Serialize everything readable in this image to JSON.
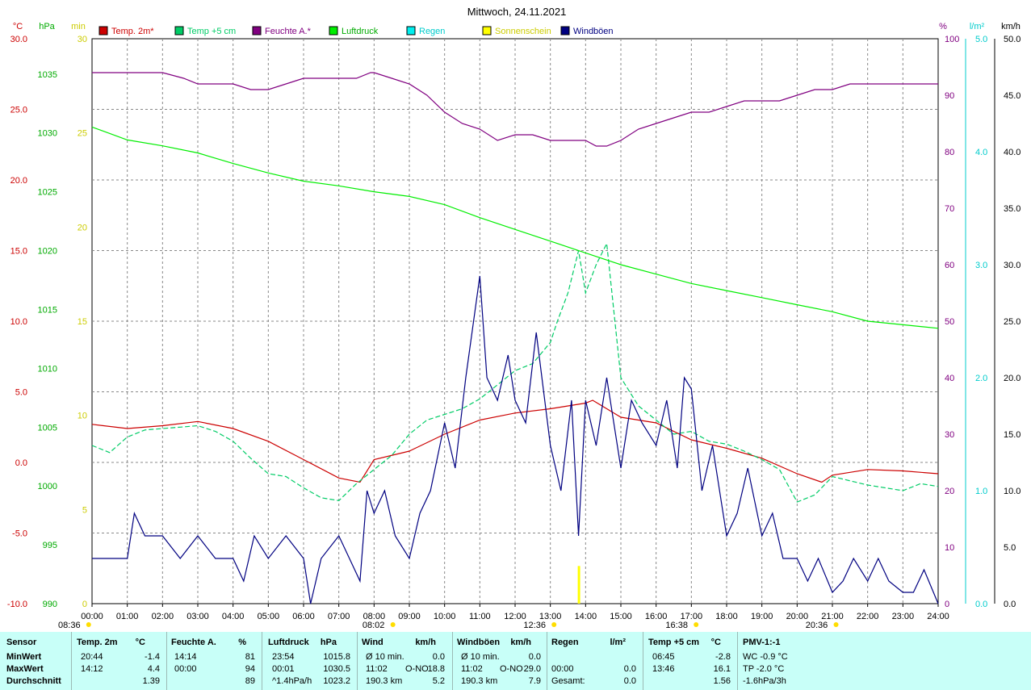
{
  "chart_data": {
    "type": "line",
    "title": "Mittwoch, 24.11.2021",
    "x_ticks": [
      "00:00",
      "01:00",
      "02:00",
      "03:00",
      "04:00",
      "05:00",
      "06:00",
      "07:00",
      "08:00",
      "09:00",
      "10:00",
      "11:00",
      "12:00",
      "13:00",
      "14:00",
      "15:00",
      "16:00",
      "17:00",
      "18:00",
      "19:00",
      "20:00",
      "21:00",
      "22:00",
      "23:00",
      "24:00"
    ],
    "axes": {
      "temp": {
        "unit": "°C",
        "ticks": [
          "30.0",
          "25.0",
          "20.0",
          "15.0",
          "10.0",
          "5.0",
          "0.0",
          "-5.0",
          "-10.0"
        ],
        "range": [
          -10,
          30
        ],
        "color": "#cc0000"
      },
      "pressure": {
        "unit": "hPa",
        "ticks": [
          "1035",
          "1030",
          "1025",
          "1020",
          "1015",
          "1010",
          "1005",
          "1000",
          "995",
          "990"
        ],
        "range": [
          990,
          1038
        ],
        "color": "#00aa00"
      },
      "sunshine": {
        "unit": "min",
        "ticks": [
          "30",
          "25",
          "20",
          "15",
          "10",
          "5",
          "0"
        ],
        "range": [
          0,
          30
        ],
        "color": "#cccc00"
      },
      "humidity": {
        "unit": "%",
        "ticks": [
          "100",
          "90",
          "80",
          "70",
          "60",
          "50",
          "40",
          "30",
          "20",
          "10",
          "0"
        ],
        "range": [
          0,
          100
        ],
        "color": "#800080"
      },
      "rain": {
        "unit": "l/m²",
        "ticks": [
          "5.0",
          "4.0",
          "3.0",
          "2.0",
          "1.0",
          "0.0"
        ],
        "range": [
          0,
          5
        ],
        "color": "#00cccc"
      },
      "wind": {
        "unit": "km/h",
        "ticks": [
          "50.0",
          "45.0",
          "40.0",
          "35.0",
          "30.0",
          "25.0",
          "20.0",
          "15.0",
          "10.0",
          "5.0",
          "0.0"
        ],
        "range": [
          0,
          50
        ],
        "color": "#000000"
      }
    },
    "legend": [
      {
        "name": "Temp. 2m*",
        "color": "#cc0000"
      },
      {
        "name": "Temp +5 cm",
        "color": "#00cc66"
      },
      {
        "name": "Feuchte A.*",
        "color": "#800080"
      },
      {
        "name": "Luftdruck",
        "color": "#00ee00"
      },
      {
        "name": "Regen",
        "color": "#00eeee"
      },
      {
        "name": "Sonnenschein",
        "color": "#ffff00"
      },
      {
        "name": "Windböen",
        "color": "#000080"
      }
    ],
    "series": [
      {
        "name": "Temp. 2m*",
        "axis": "temp",
        "color": "#cc0000",
        "x": [
          0,
          1,
          2,
          3,
          4,
          5,
          6,
          7,
          7.6,
          8,
          9,
          10,
          11,
          12,
          13,
          14,
          14.2,
          15,
          16,
          17,
          18,
          19,
          20,
          20.7,
          21,
          22,
          23,
          24
        ],
        "y": [
          2.7,
          2.4,
          2.6,
          2.9,
          2.4,
          1.5,
          0.2,
          -1.1,
          -1.4,
          0.2,
          0.8,
          2.0,
          3.0,
          3.5,
          3.8,
          4.2,
          4.4,
          3.2,
          2.8,
          1.6,
          1.0,
          0.3,
          -0.8,
          -1.4,
          -0.9,
          -0.5,
          -0.6,
          -0.8
        ]
      },
      {
        "name": "Temp +5 cm",
        "axis": "temp",
        "color": "#00cc66",
        "x": [
          0,
          0.5,
          1,
          1.5,
          2,
          2.5,
          3,
          3.5,
          4,
          4.5,
          5,
          5.5,
          6,
          6.5,
          7,
          7.5,
          8,
          8.5,
          9,
          9.5,
          10,
          10.5,
          11,
          11.5,
          12,
          12.5,
          13,
          13.2,
          13.5,
          13.8,
          14,
          14.3,
          14.6,
          15,
          15.5,
          16,
          16.5,
          17,
          17.5,
          18,
          18.5,
          19,
          19.5,
          20,
          20.5,
          21,
          21.5,
          22,
          22.5,
          23,
          23.5,
          24
        ],
        "y": [
          1.2,
          0.7,
          1.8,
          2.3,
          2.4,
          2.5,
          2.6,
          2.2,
          1.5,
          0.3,
          -0.8,
          -1.0,
          -1.8,
          -2.5,
          -2.7,
          -1.5,
          -0.5,
          0.5,
          2.0,
          3.0,
          3.4,
          3.8,
          4.5,
          5.5,
          6.5,
          7.0,
          8.5,
          10,
          12,
          15,
          12,
          14,
          15.5,
          6,
          4,
          3,
          2,
          2.2,
          1.5,
          1.3,
          0.8,
          0.2,
          -0.5,
          -2.8,
          -2.3,
          -1.0,
          -1.3,
          -1.6,
          -1.8,
          -2.0,
          -1.5,
          -1.7
        ]
      },
      {
        "name": "Feuchte A.*",
        "axis": "humidity",
        "color": "#800080",
        "x": [
          0,
          1,
          2,
          2.6,
          3,
          4,
          4.5,
          5,
          5.5,
          6,
          7,
          7.5,
          7.9,
          8,
          8.5,
          9,
          9.5,
          10,
          10.5,
          11,
          11.5,
          12,
          12.5,
          13,
          13.5,
          14,
          14.3,
          14.6,
          15,
          15.5,
          16,
          16.5,
          17,
          17.5,
          18,
          18.5,
          19,
          19.5,
          20,
          20.5,
          21,
          21.5,
          22,
          22.5,
          23,
          23.5,
          24
        ],
        "y": [
          94,
          94,
          94,
          93,
          92,
          92,
          91,
          91,
          92,
          93,
          93,
          93,
          94,
          94,
          93,
          92,
          90,
          87,
          85,
          84,
          82,
          83,
          83,
          82,
          82,
          82,
          81,
          81,
          82,
          84,
          85,
          86,
          87,
          87,
          88,
          89,
          89,
          89,
          90,
          91,
          91,
          92,
          92,
          92,
          92,
          92,
          92
        ]
      },
      {
        "name": "Luftdruck",
        "axis": "pressure",
        "color": "#00ee00",
        "x": [
          0,
          1,
          2,
          3,
          4,
          5,
          6,
          7,
          8,
          9,
          10,
          11,
          12,
          13,
          14,
          15,
          16,
          17,
          18,
          19,
          20,
          21,
          22,
          23,
          24
        ],
        "y": [
          1030.5,
          1029.4,
          1028.9,
          1028.3,
          1027.4,
          1026.6,
          1025.9,
          1025.5,
          1025.0,
          1024.6,
          1023.9,
          1022.8,
          1021.8,
          1020.8,
          1019.8,
          1018.8,
          1018.0,
          1017.2,
          1016.6,
          1016.0,
          1015.4,
          1014.8,
          1014.0,
          1013.7,
          1013.4
        ]
      },
      {
        "name": "Windböen",
        "axis": "wind",
        "color": "#000080",
        "x": [
          0,
          0.5,
          1,
          1.2,
          1.5,
          2,
          2.5,
          3,
          3.5,
          4,
          4.3,
          4.6,
          5,
          5.5,
          6,
          6.2,
          6.5,
          7,
          7.3,
          7.6,
          7.8,
          8,
          8.3,
          8.6,
          9,
          9.3,
          9.6,
          10,
          10.3,
          10.6,
          11,
          11.2,
          11.5,
          11.8,
          12,
          12.3,
          12.6,
          13,
          13.3,
          13.6,
          13.8,
          14,
          14.3,
          14.6,
          15,
          15.3,
          15.6,
          16,
          16.3,
          16.6,
          16.8,
          17,
          17.3,
          17.6,
          18,
          18.3,
          18.6,
          19,
          19.3,
          19.6,
          20,
          20.3,
          20.6,
          21,
          21.3,
          21.6,
          22,
          22.3,
          22.6,
          23,
          23.3,
          23.6,
          24
        ],
        "y": [
          4,
          4,
          4,
          8,
          6,
          6,
          4,
          6,
          4,
          4,
          2,
          6,
          4,
          6,
          4,
          0,
          4,
          6,
          4,
          2,
          10,
          8,
          10,
          6,
          4,
          8,
          10,
          16,
          12,
          20,
          29,
          20,
          18,
          22,
          18,
          16,
          24,
          14,
          10,
          18,
          6,
          18,
          14,
          20,
          12,
          18,
          16,
          14,
          18,
          12,
          20,
          19,
          10,
          14,
          6,
          8,
          12,
          6,
          8,
          4,
          4,
          2,
          4,
          1,
          2,
          4,
          2,
          4,
          2,
          1,
          1,
          3,
          0
        ]
      },
      {
        "name": "Sonnenschein",
        "axis": "sunshine",
        "color": "#ffff00",
        "type": "bar",
        "x": [
          13.8
        ],
        "y": [
          2.0
        ]
      }
    ],
    "sun_markers": [
      {
        "label": "08:36",
        "x": -0.6
      },
      {
        "label": "08:02",
        "x": 8.03
      },
      {
        "label": "12:36",
        "x": 12.6
      },
      {
        "label": "16:38",
        "x": 16.63
      },
      {
        "label": "20:36",
        "x": 20.6
      }
    ]
  },
  "table": {
    "headers": [
      "Sensor",
      "Temp. 2m",
      "°C",
      "Feuchte A.",
      "%",
      "Luftdruck",
      "hPa",
      "Wind",
      "km/h",
      "Windböen",
      "km/h",
      "Regen",
      "l/m²",
      "Temp +5 cm",
      "°C",
      "PMV-1:-1"
    ],
    "rows": [
      {
        "label": "MinWert",
        "temp_t": "20:44",
        "temp_v": "-1.4",
        "hum_t": "14:14",
        "hum_v": "81",
        "press_t": "23:54",
        "press_v": "1015.8",
        "wind_t": "Ø 10 min.",
        "wind_d": "",
        "wind_v": "0.0",
        "gust_t": "Ø 10 min.",
        "gust_d": "",
        "gust_v": "0.0",
        "rain_t": "",
        "rain_v": "",
        "t5_t": "06:45",
        "t5_v": "-2.8",
        "pmv": "WC -0.9 °C"
      },
      {
        "label": "MaxWert",
        "temp_t": "14:12",
        "temp_v": "4.4",
        "hum_t": "00:00",
        "hum_v": "94",
        "press_t": "00:01",
        "press_v": "1030.5",
        "wind_t": "11:02",
        "wind_d": "O-NO",
        "wind_v": "18.8",
        "gust_t": "11:02",
        "gust_d": "O-NO",
        "gust_v": "29.0",
        "rain_t": "00:00",
        "rain_v": "0.0",
        "t5_t": "13:46",
        "t5_v": "16.1",
        "pmv": "TP -2.0 °C"
      },
      {
        "label": "Durchschnitt",
        "temp_t": "",
        "temp_v": "1.39",
        "hum_t": "",
        "hum_v": "89",
        "press_t": "^1.4hPa/h",
        "press_v": "1023.2",
        "wind_t": "190.3 km",
        "wind_d": "",
        "wind_v": "5.2",
        "gust_t": "190.3 km",
        "gust_d": "",
        "gust_v": "7.9",
        "rain_t": "Gesamt:",
        "rain_v": "0.0",
        "t5_t": "",
        "t5_v": "1.56",
        "pmv": "-1.6hPa/3h"
      }
    ]
  }
}
